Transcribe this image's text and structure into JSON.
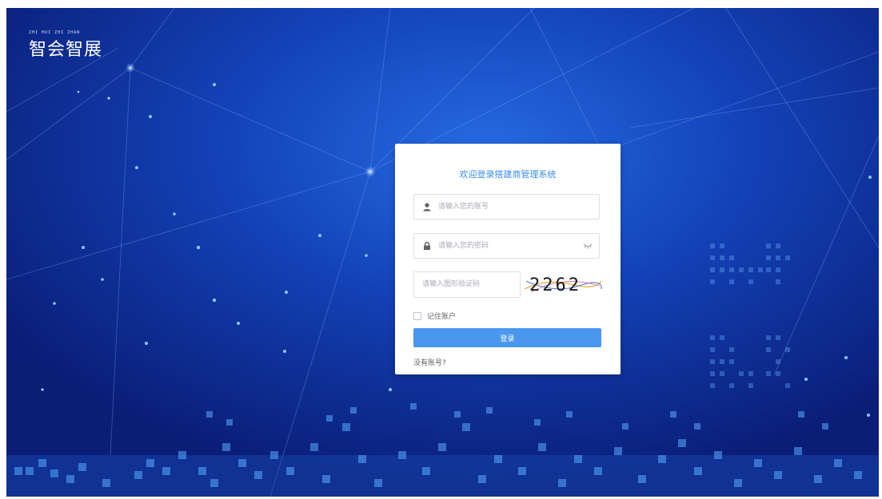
{
  "brand": {
    "logo_text": "智会智展",
    "logo_small_text": "ZHI HUI ZHI ZHAN"
  },
  "login": {
    "title": "欢迎登录搭建商管理系统",
    "account_placeholder": "请输入您的账号",
    "password_placeholder": "请输入您的密码",
    "captcha_placeholder": "请输入图形验证码",
    "captcha_text": "2262",
    "remember_label": "记住账户",
    "remember_checked": false,
    "submit_label": "登录",
    "register_link": "没有账号?"
  },
  "icons": {
    "account": "user-icon",
    "password": "lock-icon",
    "visibility": "eye-closed-icon"
  },
  "colors": {
    "accent": "#4a97ee",
    "title": "#3a8ee6",
    "background_dark": "#0a1a6b",
    "background_light": "#1e6ee0"
  }
}
